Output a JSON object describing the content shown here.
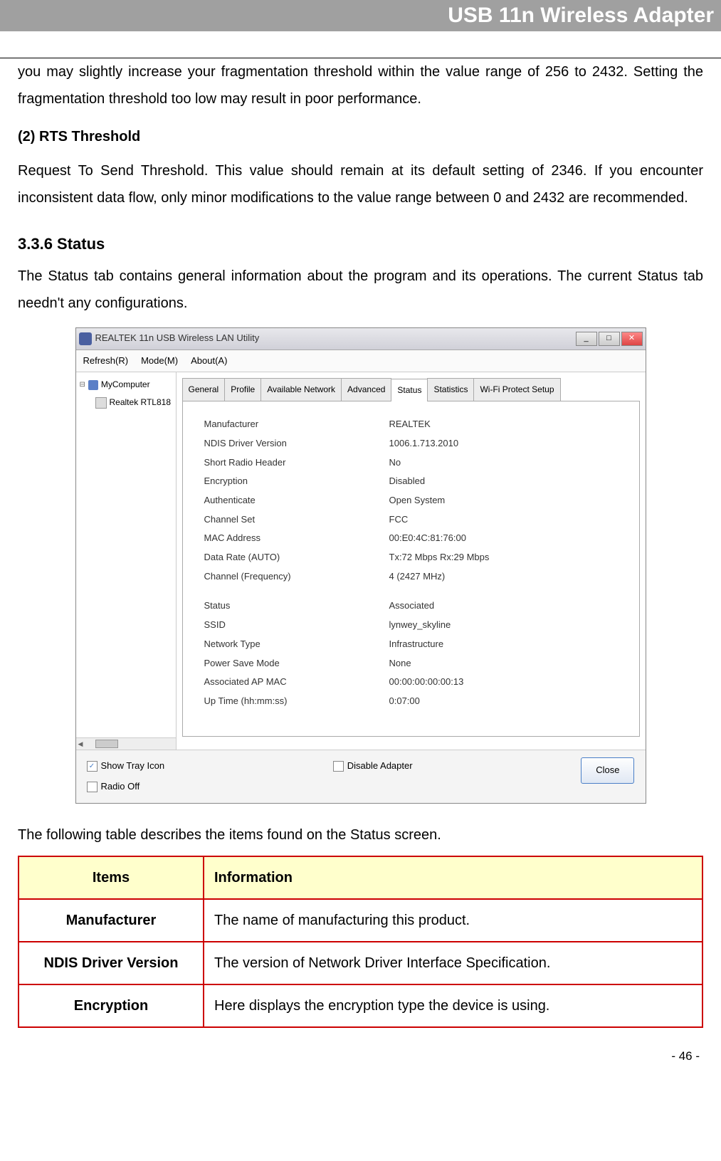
{
  "header": {
    "title": "USB 11n Wireless Adapter"
  },
  "body": {
    "p1": "you may slightly increase your fragmentation threshold within the value range of 256 to 2432. Setting the fragmentation threshold too low may result in poor performance.",
    "h2": "(2) RTS Threshold",
    "p2": "Request To Send Threshold. This value should remain at its default setting of 2346. If you encounter inconsistent data flow, only minor modifications to the value range between 0 and 2432 are recommended.",
    "h_section": "3.3.6  Status",
    "p3": "The Status tab contains general information about the program and its operations. The current Status tab needn't any configurations.",
    "p4": "The following table describes the items found on the Status screen."
  },
  "app": {
    "title": "REALTEK 11n USB Wireless LAN Utility",
    "menu": [
      "Refresh(R)",
      "Mode(M)",
      "About(A)"
    ],
    "tree": {
      "root": "MyComputer",
      "child": "Realtek RTL818"
    },
    "tabs": [
      "General",
      "Profile",
      "Available Network",
      "Advanced",
      "Status",
      "Statistics",
      "Wi-Fi Protect Setup"
    ],
    "active_tab": "Status",
    "status_rows_1": [
      {
        "label": "Manufacturer",
        "value": "REALTEK"
      },
      {
        "label": "NDIS Driver Version",
        "value": "1006.1.713.2010"
      },
      {
        "label": "Short Radio Header",
        "value": "No"
      },
      {
        "label": "Encryption",
        "value": "Disabled"
      },
      {
        "label": "Authenticate",
        "value": "Open System"
      },
      {
        "label": "Channel Set",
        "value": "FCC"
      },
      {
        "label": "MAC Address",
        "value": "00:E0:4C:81:76:00"
      },
      {
        "label": "Data Rate (AUTO)",
        "value": "Tx:72 Mbps Rx:29 Mbps"
      },
      {
        "label": "Channel (Frequency)",
        "value": "4 (2427 MHz)"
      }
    ],
    "status_rows_2": [
      {
        "label": "Status",
        "value": "Associated"
      },
      {
        "label": "SSID",
        "value": "lynwey_skyline"
      },
      {
        "label": "Network Type",
        "value": "Infrastructure"
      },
      {
        "label": "Power Save Mode",
        "value": "None"
      },
      {
        "label": "Associated AP MAC",
        "value": "00:00:00:00:00:13"
      },
      {
        "label": "Up Time (hh:mm:ss)",
        "value": "0:07:00"
      }
    ],
    "bottom": {
      "show_tray": "Show Tray Icon",
      "radio_off": "Radio Off",
      "disable_adapter": "Disable Adapter",
      "close": "Close"
    }
  },
  "table": {
    "headers": [
      "Items",
      "Information"
    ],
    "rows": [
      {
        "item": "Manufacturer",
        "info": "The name of manufacturing this product."
      },
      {
        "item": "NDIS Driver Version",
        "info": "The version of Network Driver Interface Specification."
      },
      {
        "item": "Encryption",
        "info": "Here displays the encryption type the device is using."
      }
    ]
  },
  "footer": {
    "page": "- 46 -"
  }
}
